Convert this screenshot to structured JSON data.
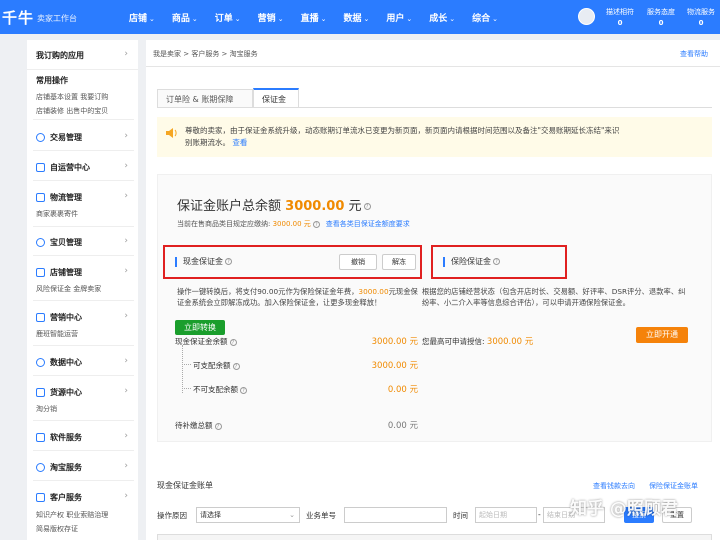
{
  "topbar": {
    "logo": "千牛",
    "logo_sub": "卖家工作台",
    "nav": [
      "店铺",
      "商品",
      "订单",
      "营销",
      "直播",
      "数据",
      "用户",
      "成长",
      "综合"
    ],
    "stats": [
      {
        "label": "描述相符",
        "value": "0"
      },
      {
        "label": "服务态度",
        "value": "0"
      },
      {
        "label": "物流服务",
        "value": "0"
      }
    ]
  },
  "sidebar": {
    "my_apps": "我订购的应用",
    "common_ops": "常用操作",
    "common_links_1": "店铺基本设置  我要订购",
    "common_links_2": "店铺装修      出售中的宝贝",
    "items": [
      {
        "label": "交易管理",
        "icon": "trade-icon"
      },
      {
        "label": "自运营中心",
        "icon": "chat-icon"
      },
      {
        "label": "物流管理",
        "icon": "logistics-icon",
        "sub": "商家裹裹寄件"
      },
      {
        "label": "宝贝管理",
        "icon": "goods-icon"
      },
      {
        "label": "店铺管理",
        "icon": "shop-icon",
        "sub": "风险保证金    金牌卖家"
      },
      {
        "label": "营销中心",
        "icon": "marketing-icon",
        "sub": "鹿班智能运营"
      },
      {
        "label": "数据中心",
        "icon": "data-icon"
      },
      {
        "label": "货源中心",
        "icon": "supply-icon",
        "sub": "淘分销"
      },
      {
        "label": "软件服务",
        "icon": "software-icon"
      },
      {
        "label": "淘宝服务",
        "icon": "taobao-service-icon"
      },
      {
        "label": "客户服务",
        "icon": "customer-service-icon",
        "sub": "知识产权      职业索赔治理",
        "sub2": "简易版权存证"
      }
    ]
  },
  "main": {
    "breadcrumb": "我是卖家  >  客户服务  >  淘宝服务",
    "help": "查看帮助",
    "tabs": [
      "订单险 & 账期保障",
      "保证金"
    ],
    "notice": "尊敬的卖家，由于保证金系统升级，动态账期订单流水已变更为新页面，新页面内请根据时间范围以及备注\"交易账期延长冻结\"来识别账期流水。",
    "notice_link": "查看",
    "account_title_prefix": "保证金账户总余额",
    "account_amount": "3000.00",
    "account_unit": "元",
    "required_label": "当前在售商品类目规定应缴纳:",
    "required_amount": "3000.00 元",
    "required_link": "查看各类目保证金额度要求",
    "cash": {
      "title": "现金保证金",
      "withdraw": "撤销",
      "unfreeze": "解冻",
      "desc_1": "操作一键转换后，将支付90.00元作为保险保证金年费，",
      "desc_amount": "3000.00",
      "desc_2": "元现金保证金系统会立即解冻成功。加入保险保证金，让更多现金释放！",
      "convert": "立即转换",
      "rows": [
        {
          "label": "现金保证金余额",
          "value": "3000.00 元"
        },
        {
          "label": "可支配余额",
          "value": "3000.00 元"
        },
        {
          "label": "不可支配余额",
          "value": "0.00 元"
        },
        {
          "label": "待补缴总额",
          "value": "0.00 元"
        }
      ]
    },
    "insurance": {
      "title": "保险保证金",
      "desc": "根据您的店铺经营状态（包含开店时长、交易额、好评率、DSR评分、退款率、纠纷率、小二介入率等信息综合评估），可以申请开通保险保证金。",
      "credit_label": "您最高可申请授信:",
      "credit_amount": "3000.00 元",
      "open": "立即开通"
    },
    "ledger": {
      "title": "现金保证金账单",
      "link_1": "查看钱款去向",
      "link_2": "保险保证金账单",
      "reason_label": "操作原因",
      "reason_value": "请选择",
      "biz_label": "业务单号",
      "time_label": "时间",
      "start_ph": "起始日期",
      "end_ph": "结束日期",
      "search": "搜索",
      "reset": "重置"
    }
  },
  "watermark": "知乎 @照顾君"
}
